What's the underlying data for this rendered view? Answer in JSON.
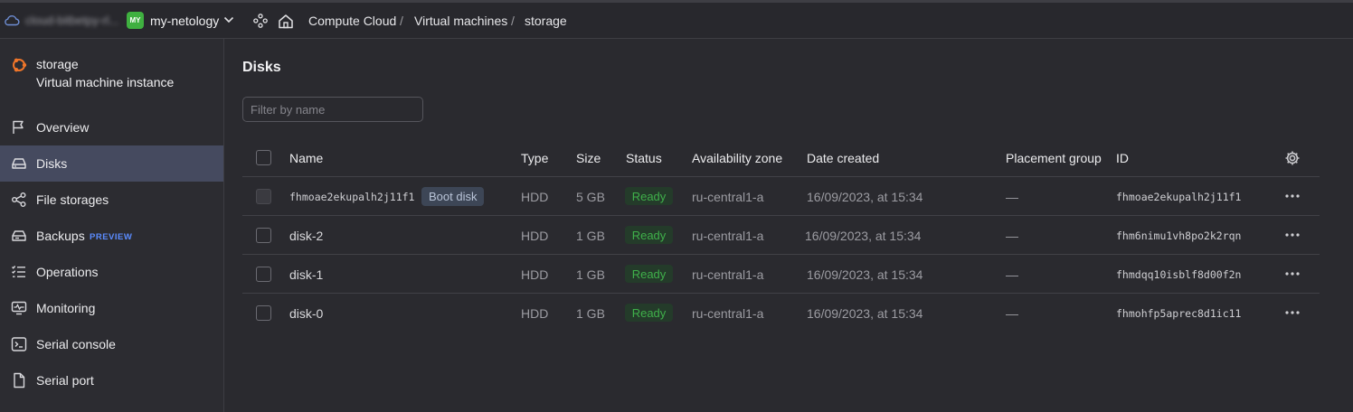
{
  "topbar": {
    "cloud_name": "cloud-bitbetpy-rl...",
    "folder_badge": "MY",
    "folder_name": "my-netology",
    "breadcrumbs": [
      "Compute Cloud",
      "Virtual machines",
      "storage"
    ],
    "separator": "/"
  },
  "sidebar": {
    "vm_name": "storage",
    "vm_kind": "Virtual machine instance",
    "items": [
      {
        "label": "Overview",
        "icon": "flag-icon"
      },
      {
        "label": "Disks",
        "icon": "disk-icon",
        "active": true
      },
      {
        "label": "File storages",
        "icon": "share-icon"
      },
      {
        "label": "Backups",
        "icon": "backup-icon",
        "tag": "PREVIEW"
      },
      {
        "label": "Operations",
        "icon": "list-icon"
      },
      {
        "label": "Monitoring",
        "icon": "monitor-icon"
      },
      {
        "label": "Serial console",
        "icon": "terminal-icon"
      },
      {
        "label": "Serial port",
        "icon": "file-icon"
      }
    ]
  },
  "main": {
    "title": "Disks",
    "filter_placeholder": "Filter by name",
    "columns": [
      "Name",
      "Type",
      "Size",
      "Status",
      "Availability zone",
      "Date created",
      "Placement group",
      "ID"
    ],
    "rows": [
      {
        "name": "fhmoae2ekupalh2j11f1",
        "tag": "Boot disk",
        "type": "HDD",
        "size": "5 GB",
        "status": "Ready",
        "zone": "ru-central1-a",
        "date": "16/09/2023, at 15:34",
        "placement": "—",
        "id": "fhmoae2ekupalh2j11f1"
      },
      {
        "name": "disk-2",
        "type": "HDD",
        "size": "1 GB",
        "status": "Ready",
        "zone": "ru-central1-a",
        "date": "16/09/2023, at 15:34",
        "placement": "—",
        "id": "fhm6nimu1vh8po2k2rqn"
      },
      {
        "name": "disk-1",
        "type": "HDD",
        "size": "1 GB",
        "status": "Ready",
        "zone": "ru-central1-a",
        "date": "16/09/2023, at 15:34",
        "placement": "—",
        "id": "fhmdqq10isblf8d00f2n"
      },
      {
        "name": "disk-0",
        "type": "HDD",
        "size": "1 GB",
        "status": "Ready",
        "zone": "ru-central1-a",
        "date": "16/09/2023, at 15:34",
        "placement": "—",
        "id": "fhmohfp5aprec8d1ic11"
      }
    ]
  },
  "colors": {
    "accent": "#5b8cff",
    "status_ready": "#3fb04a",
    "folder_badge": "#3fb040",
    "vm_icon": "#f0762a",
    "active_nav": "#454a5f"
  }
}
